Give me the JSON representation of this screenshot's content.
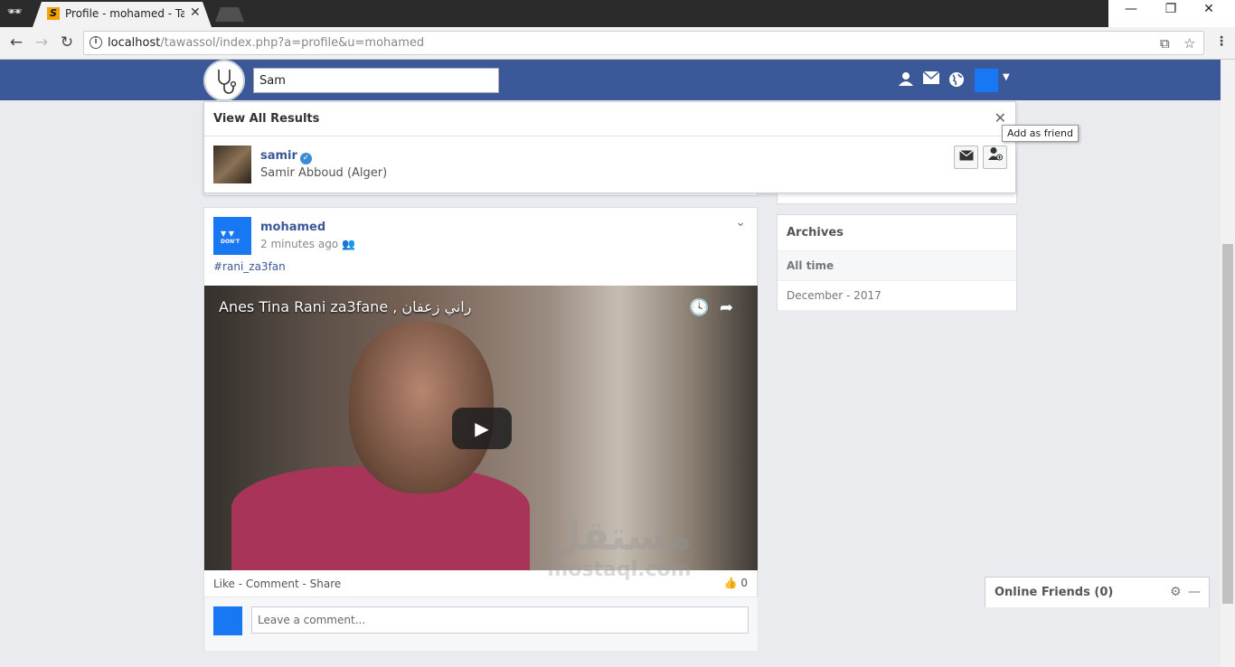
{
  "browser": {
    "tab_title": "Profile - mohamed - Tawassol",
    "tab_favicon": "S",
    "url_host": "localhost",
    "url_path": "/tawassol/index.php?a=profile&u=mohamed",
    "win_minimize": "—",
    "win_restore": "❐",
    "win_close": "✕"
  },
  "header": {
    "search_value": "Sam"
  },
  "search_results": {
    "view_all": "View All Results",
    "close": "✕",
    "result": {
      "name": "samir",
      "subtitle": "Samir Abboud (Alger)"
    },
    "tooltip": "Add as friend"
  },
  "post": {
    "author": "mohamed",
    "time": "2 minutes ago",
    "hashtag": "#rani_za3fan",
    "video_title": "Anes Tina Rani za3fane , راني زعفان",
    "actions": "Like - Comment - Share",
    "like_count": "0",
    "comment_placeholder": "Leave a comment...",
    "avatar_text": "DON'T"
  },
  "archives": {
    "title": "Archives",
    "items": [
      {
        "label": "All time"
      },
      {
        "label": "December - 2017"
      }
    ]
  },
  "chat": {
    "label": "Online Friends (0)"
  },
  "watermark": {
    "arabic": "مستقل",
    "latin": "mostaql.com"
  },
  "colors": {
    "header_blue": "#3b5998",
    "avatar_blue": "#1877f2",
    "page_bg": "#e9ebee"
  }
}
